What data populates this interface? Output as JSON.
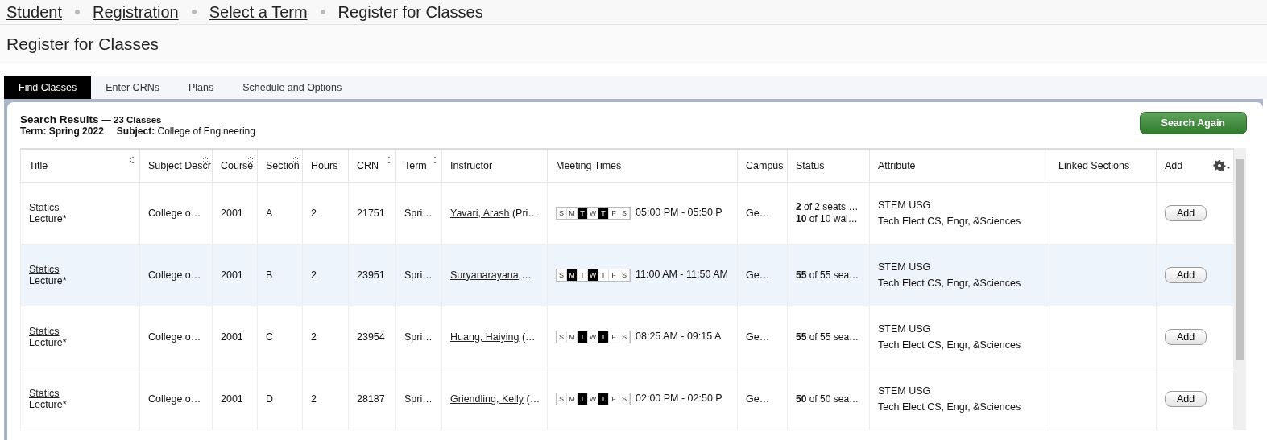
{
  "breadcrumb": [
    {
      "label": "Student",
      "link": true
    },
    {
      "label": "Registration",
      "link": true
    },
    {
      "label": "Select a Term",
      "link": true
    },
    {
      "label": "Register for Classes",
      "link": false
    }
  ],
  "page_title": "Register for Classes",
  "tabs": [
    {
      "label": "Find Classes",
      "selected": true
    },
    {
      "label": "Enter CRNs",
      "selected": false
    },
    {
      "label": "Plans",
      "selected": false
    },
    {
      "label": "Schedule and Options",
      "selected": false
    }
  ],
  "results": {
    "heading": "Search Results",
    "count": "— 23 Classes",
    "term": "Term: Spring 2022",
    "subject_label": "Subject:",
    "subject": "College of Engineering",
    "search_again": "Search Again"
  },
  "columns": [
    {
      "label": "Title",
      "sortable": true
    },
    {
      "label": "Subject Descr",
      "sortable": true
    },
    {
      "label": "Course",
      "sortable": true
    },
    {
      "label": "Section",
      "sortable": true
    },
    {
      "label": "Hours",
      "sortable": false
    },
    {
      "label": "CRN",
      "sortable": true
    },
    {
      "label": "Term",
      "sortable": true
    },
    {
      "label": "Instructor",
      "sortable": false
    },
    {
      "label": "Meeting Times",
      "sortable": false
    },
    {
      "label": "Campus",
      "sortable": false
    },
    {
      "label": "Status",
      "sortable": false
    },
    {
      "label": "Attribute",
      "sortable": false
    },
    {
      "label": "Linked Sections",
      "sortable": false
    },
    {
      "label": "Add",
      "sortable": false
    }
  ],
  "rows": [
    {
      "selected": false,
      "title": "Statics",
      "type": "Lecture*",
      "subject": "College o…",
      "course": "2001",
      "section": "A",
      "hours": "2",
      "crn": "21751",
      "term": "Spri…",
      "instructor": "Yavari, Arash",
      "instructor_rest": " (Pri…",
      "days": [
        {
          "label": "S",
          "on": false
        },
        {
          "label": "M",
          "on": false
        },
        {
          "label": "T",
          "on": true
        },
        {
          "label": "W",
          "on": false
        },
        {
          "label": "T",
          "on": true
        },
        {
          "label": "F",
          "on": false
        },
        {
          "label": "S",
          "on": false
        }
      ],
      "time": "05:00 PM - 05:50 P",
      "campus": "Ge…",
      "status": [
        "**2** of 2 seats …",
        "**10** of 10 wai…"
      ],
      "attributes": [
        "STEM USG",
        "Tech Elect CS, Engr, &Sciences"
      ],
      "add": "Add"
    },
    {
      "selected": true,
      "title": "Statics",
      "type": "Lecture*",
      "subject": "College o…",
      "course": "2001",
      "section": "B",
      "hours": "2",
      "crn": "23951",
      "term": "Spri…",
      "instructor": "Suryanarayana,",
      "instructor_rest": "…",
      "days": [
        {
          "label": "S",
          "on": false
        },
        {
          "label": "M",
          "on": true
        },
        {
          "label": "T",
          "on": false
        },
        {
          "label": "W",
          "on": true
        },
        {
          "label": "T",
          "on": false
        },
        {
          "label": "F",
          "on": false
        },
        {
          "label": "S",
          "on": false
        }
      ],
      "time": "11:00 AM - 11:50 AM",
      "campus": "Ge…",
      "status": [
        "**55** of 55 sea…"
      ],
      "attributes": [
        "STEM USG",
        "Tech Elect CS, Engr, &Sciences"
      ],
      "add": "Add"
    },
    {
      "selected": false,
      "title": "Statics",
      "type": "Lecture*",
      "subject": "College o…",
      "course": "2001",
      "section": "C",
      "hours": "2",
      "crn": "23954",
      "term": "Spri…",
      "instructor": "Huang, Haiying",
      "instructor_rest": " (…",
      "days": [
        {
          "label": "S",
          "on": false
        },
        {
          "label": "M",
          "on": false
        },
        {
          "label": "T",
          "on": true
        },
        {
          "label": "W",
          "on": false
        },
        {
          "label": "T",
          "on": true
        },
        {
          "label": "F",
          "on": false
        },
        {
          "label": "S",
          "on": false
        }
      ],
      "time": "08:25 AM - 09:15 A",
      "campus": "Ge…",
      "status": [
        "**55** of 55 sea…"
      ],
      "attributes": [
        "STEM USG",
        "Tech Elect CS, Engr, &Sciences"
      ],
      "add": "Add"
    },
    {
      "selected": false,
      "title": "Statics",
      "type": "Lecture*",
      "subject": "College o…",
      "course": "2001",
      "section": "D",
      "hours": "2",
      "crn": "28187",
      "term": "Spri…",
      "instructor": "Griendling, Kelly",
      "instructor_rest": " (…",
      "days": [
        {
          "label": "S",
          "on": false
        },
        {
          "label": "M",
          "on": false
        },
        {
          "label": "T",
          "on": true
        },
        {
          "label": "W",
          "on": false
        },
        {
          "label": "T",
          "on": true
        },
        {
          "label": "F",
          "on": false
        },
        {
          "label": "S",
          "on": false
        }
      ],
      "time": "02:00 PM - 02:50 P",
      "campus": "Ge…",
      "status": [
        "**50** of 50 sea…"
      ],
      "attributes": [
        "STEM USG",
        "Tech Elect CS, Engr, &Sciences"
      ],
      "add": "Add"
    }
  ]
}
